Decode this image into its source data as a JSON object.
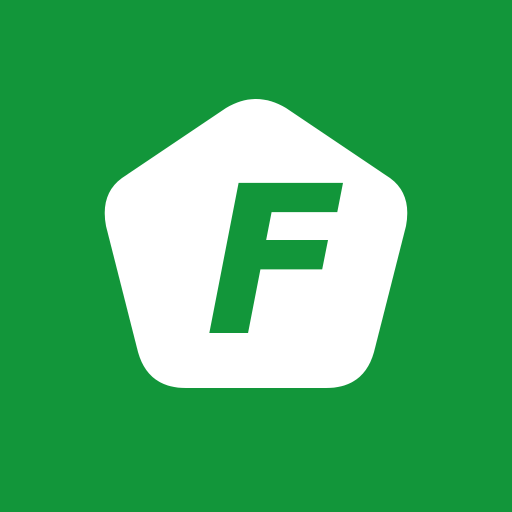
{
  "icon": {
    "name": "fleet-app-icon",
    "letter": "F"
  },
  "colors": {
    "background": "#12963a",
    "badge": "#ffffff",
    "letter": "#12963a"
  }
}
